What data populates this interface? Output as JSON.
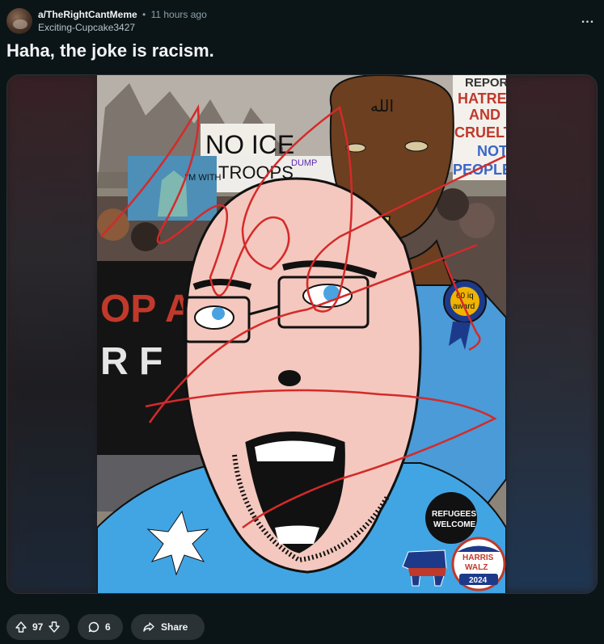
{
  "post": {
    "subreddit": "a/TheRightCantMeme",
    "time_ago": "11 hours ago",
    "separator": "•",
    "username": "Exciting-Cupcake3427",
    "title": "Haha, the joke is racism.",
    "more_label": "..."
  },
  "meme": {
    "signs": {
      "noice": "NO ICE",
      "troops": "TROOPS",
      "im_with": "I'M WITH",
      "dump": "DUMP",
      "report": "REPORT",
      "hatred": "HATRED",
      "and": "AND",
      "cruelty": "CRUELTY",
      "not": "NOT",
      "people": "PEOPLE",
      "banner_top": "OP A",
      "banner_bottom": "R F",
      "arabic": "الله"
    },
    "badges": {
      "award_line1": "60 iq",
      "award_line2": "award",
      "refugees_line1": "REFUGEES",
      "refugees_line2": "WELCOME",
      "campaign_line1": "HARRIS",
      "campaign_line2": "WALZ",
      "campaign_year": "2024"
    }
  },
  "actions": {
    "upvotes": "97",
    "comments": "6",
    "share_label": "Share"
  },
  "colors": {
    "background": "#0b1416",
    "pill": "#2a3236",
    "scribble": "#d42a2a",
    "somali_blue": "#41a5e4"
  }
}
